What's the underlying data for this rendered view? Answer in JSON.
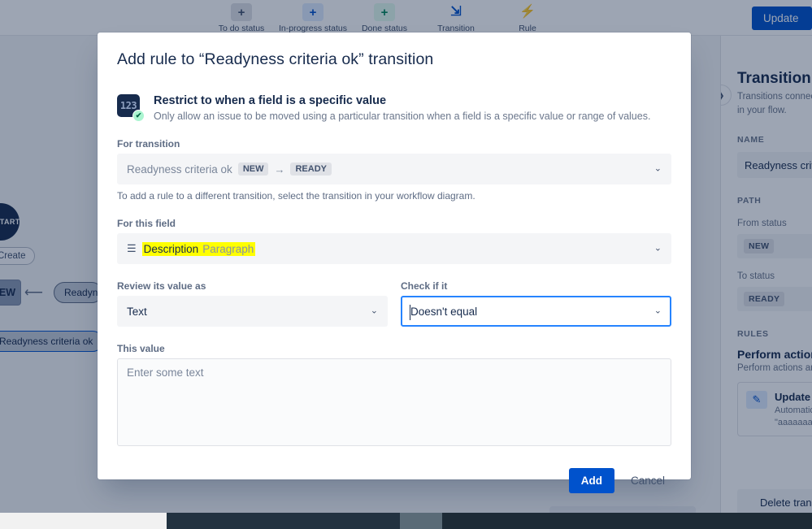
{
  "toolbar": {
    "items": [
      {
        "label": "To do status",
        "icon": "plus-icon"
      },
      {
        "label": "In-progress status",
        "icon": "plus-icon"
      },
      {
        "label": "Done status",
        "icon": "plus-icon"
      },
      {
        "label": "Transition",
        "icon": "transition-icon"
      },
      {
        "label": "Rule",
        "icon": "lightning-bolt-icon"
      }
    ],
    "update_label": "Update"
  },
  "canvas": {
    "start_node": "START",
    "create_chip": "Create",
    "new_node": "NEW",
    "readyness_chip": "Readyn",
    "criteria_chip": "Readyness criteria ok",
    "zoom": {
      "minus_icon": "zoom-out-icon",
      "plus_icon": "zoom-in-icon"
    }
  },
  "right_panel": {
    "collapse_icon": "chevron-right-icon",
    "title": "Transition",
    "subtitle": "Transitions connect statuses in your flow.",
    "name_label": "NAME",
    "name_value": "Readyness criteria ok",
    "path_label": "PATH",
    "from_status_label": "From status",
    "from_status_value": "NEW",
    "to_status_label": "To status",
    "to_status_value": "READY",
    "rules_label": "RULES",
    "rules_heading": "Perform actions",
    "rules_desc": "Perform actions and more",
    "rule_card": {
      "icon": "update-field-icon",
      "title": "Update",
      "desc": "Automatically update",
      "quote": "\"aaaaaaaaaa\""
    },
    "delete_label": "Delete transition"
  },
  "modal": {
    "title": "Add rule to “Readyness criteria ok” transition",
    "rule": {
      "icon": "number-field-check-icon",
      "icon_glyph": "123",
      "check_glyph": "✔",
      "title": "Restrict to when a field is a specific value",
      "description": "Only allow an issue to be moved using a particular transition when a field is a specific value or range of values."
    },
    "for_transition": {
      "label": "For transition",
      "value": "Readyness criteria ok",
      "from_badge": "NEW",
      "arrow": "→",
      "to_badge": "READY",
      "chevron": "⌄",
      "helper": "To add a rule to a different transition, select the transition in your workflow diagram."
    },
    "for_field": {
      "label": "For this field",
      "icon": "paragraph-lines-icon",
      "name": "Description",
      "type": "Paragraph",
      "chevron": "⌄"
    },
    "review_as": {
      "label": "Review its value as",
      "value": "Text",
      "chevron": "⌄"
    },
    "check_if": {
      "label": "Check if it",
      "value": "Doesn't equal",
      "chevron": "⌄"
    },
    "this_value": {
      "label": "This value",
      "placeholder": "Enter some text",
      "value": ""
    },
    "add_label": "Add",
    "cancel_label": "Cancel"
  },
  "colors": {
    "accent": "#0052cc",
    "focus_ring": "#2684ff",
    "highlight": "#ffff00",
    "text": "#172b4d",
    "muted": "#6b778c"
  }
}
